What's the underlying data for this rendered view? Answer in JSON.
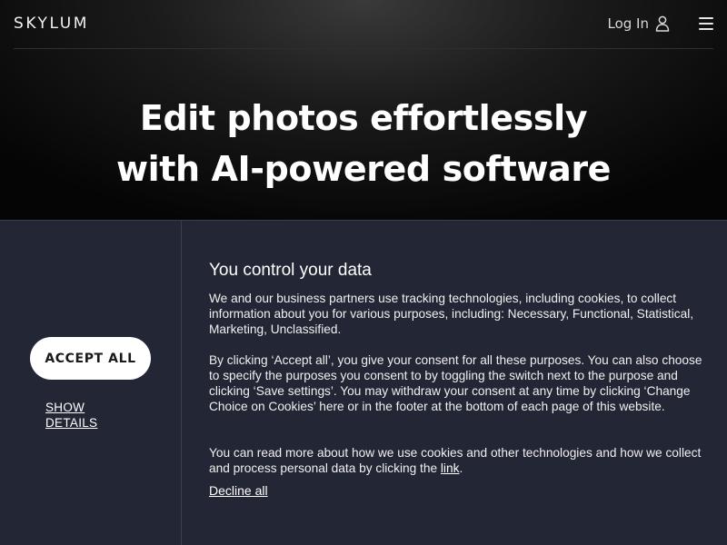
{
  "header": {
    "logo": "SKYLUM",
    "login_label": "Log In"
  },
  "hero": {
    "headline_line1": "Edit photos effortlessly",
    "headline_line2": "with AI-powered software"
  },
  "consent": {
    "accept_all_label": "ACCEPT ALL",
    "show_details_line1": "SHOW",
    "show_details_line2": "DETAILS",
    "title": "You control your data",
    "paragraph1": "We and our business partners use tracking technologies, including cookies, to collect information about you for various purposes, including: Necessary, Functional, Statistical, Marketing, Unclassified.",
    "paragraph2": "By clicking ‘Accept all’, you give your consent for all these purposes. You can also choose to specify the purposes you consent to by toggling the switch next to the purpose and clicking ‘Save settings’. You may withdraw your consent at any time by clicking ‘Change Choice on Cookies’ here or in the footer at the bottom of each page of this website.",
    "paragraph3_before_link": "You can read more about how we use cookies and other technologies and how we collect and process personal data by clicking the ",
    "paragraph3_link": "link",
    "paragraph3_after_link": ".",
    "decline_label": "Decline all"
  },
  "icons": {
    "user": "user-icon",
    "menu": "hamburger-menu-icon"
  }
}
